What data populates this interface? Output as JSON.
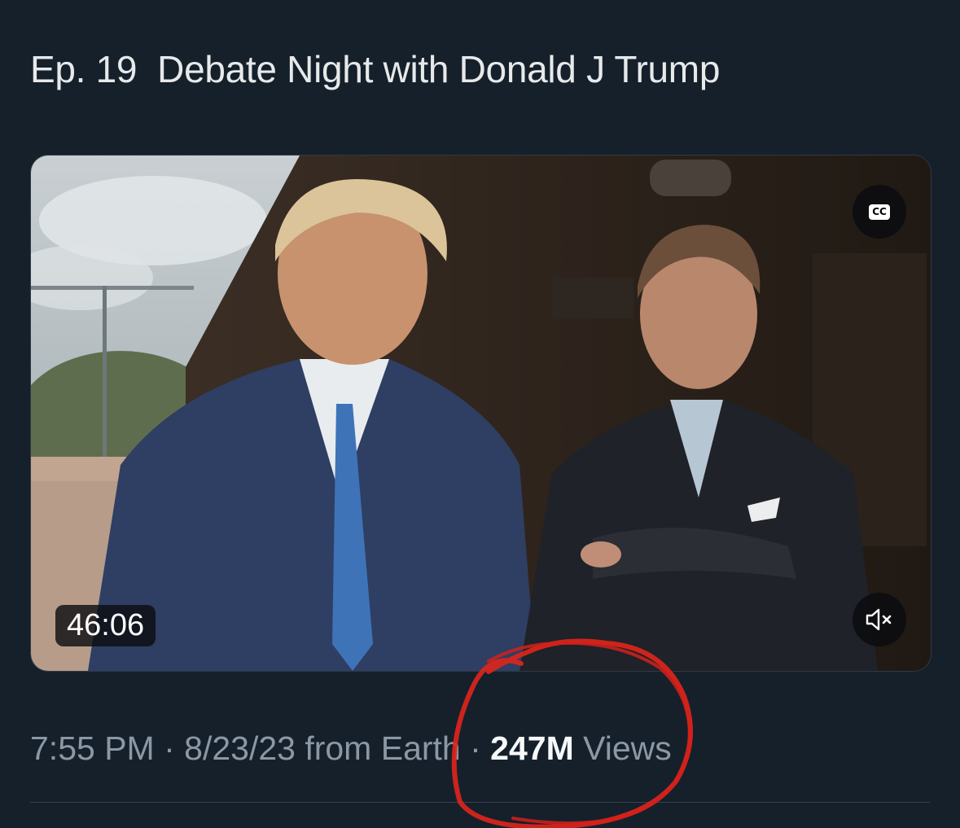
{
  "post": {
    "title": "Ep. 19  Debate Night with Donald J Trump",
    "video": {
      "duration": "46:06",
      "cc_label": "CC",
      "cc_icon": "closed-captions-icon",
      "mute_icon": "speaker-muted-icon"
    },
    "meta": {
      "time": "7:55 PM",
      "separator1": " · ",
      "date": "8/23/23",
      "source": " from Earth",
      "separator2": " · ",
      "views_count": "247M",
      "views_label": " Views"
    }
  },
  "colors": {
    "background": "#15202b",
    "title_text": "#e7e9ea",
    "meta_text": "#8b98a5",
    "annotation_circle": "#e0251b"
  }
}
